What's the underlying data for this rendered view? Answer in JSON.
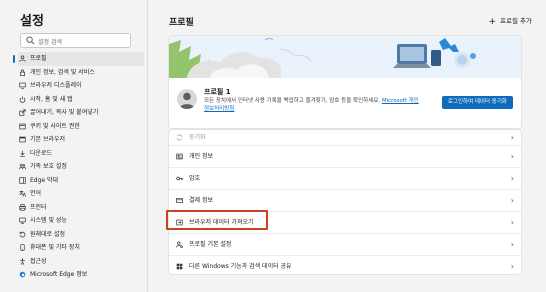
{
  "sidebar": {
    "title": "설정",
    "search_placeholder": "설정 검색",
    "items": [
      {
        "label": "프로필",
        "icon": "person-icon",
        "active": true
      },
      {
        "label": "개인 정보, 검색 및 서비스",
        "icon": "lock-icon"
      },
      {
        "label": "브라우저 디스플레이",
        "icon": "display-icon"
      },
      {
        "label": "시작, 홈 및 새 탭",
        "icon": "power-icon"
      },
      {
        "label": "끌어내기, 복사 및 붙여넣기",
        "icon": "share-icon"
      },
      {
        "label": "쿠키 및 사이트 권한",
        "icon": "cookie-icon"
      },
      {
        "label": "기본 브라우저",
        "icon": "browser-icon"
      },
      {
        "label": "다운로드",
        "icon": "download-icon"
      },
      {
        "label": "가족 보호 설정",
        "icon": "family-icon"
      },
      {
        "label": "Edge 막대",
        "icon": "bar-icon"
      },
      {
        "label": "언어",
        "icon": "language-icon"
      },
      {
        "label": "프린터",
        "icon": "printer-icon"
      },
      {
        "label": "시스템 및 성능",
        "icon": "system-icon"
      },
      {
        "label": "원래대로 설정",
        "icon": "reset-icon"
      },
      {
        "label": "휴대폰 및 기타 장치",
        "icon": "phone-icon"
      },
      {
        "label": "접근성",
        "icon": "accessibility-icon"
      },
      {
        "label": "Microsoft Edge 정보",
        "icon": "edge-icon"
      }
    ]
  },
  "main": {
    "title": "프로필",
    "add_profile": "프로필 추가",
    "profile": {
      "name": "프로필 1",
      "description": "모든 장치에서 인터넷 사용 기록을 백업하고 즐겨찾기, 암호 등을 확인하세요.",
      "link": "Microsoft 개인정보처리방침",
      "sync_button": "로그인하여 데이터 동기화"
    },
    "rows": [
      {
        "label": "동기화",
        "icon": "sync-icon",
        "disabled": true
      },
      {
        "label": "개인 정보",
        "icon": "person-card-icon"
      },
      {
        "label": "암호",
        "icon": "key-icon"
      },
      {
        "label": "결제 정보",
        "icon": "card-icon"
      },
      {
        "label": "브라우저 데이터 가져오기",
        "icon": "import-icon",
        "highlighted": true
      },
      {
        "label": "프로필 기본 설정",
        "icon": "profile-settings-icon"
      },
      {
        "label": "다른 Windows 기능과 검색 데이터 공유",
        "icon": "windows-share-icon"
      }
    ]
  },
  "colors": {
    "accent": "#0f6cbd",
    "highlight": "#c9411f"
  }
}
